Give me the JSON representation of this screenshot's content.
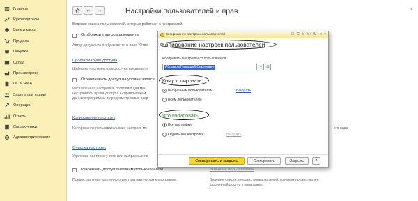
{
  "sidebar": {
    "items": [
      {
        "label": "Главное",
        "icon": "menu-icon"
      },
      {
        "label": "Руководителю",
        "icon": "chart-line-icon"
      },
      {
        "label": "Банк и касса",
        "icon": "coin-icon"
      },
      {
        "label": "Продажи",
        "icon": "cart-icon"
      },
      {
        "label": "Покупки",
        "icon": "basket-icon"
      },
      {
        "label": "Склад",
        "icon": "warehouse-icon"
      },
      {
        "label": "Производство",
        "icon": "factory-icon"
      },
      {
        "label": "ОС и НМА",
        "icon": "building-icon"
      },
      {
        "label": "Зарплата и кадры",
        "icon": "people-icon"
      },
      {
        "label": "Операции",
        "icon": "operations-icon"
      },
      {
        "label": "Отчеты",
        "icon": "report-icon"
      },
      {
        "label": "Справочники",
        "icon": "book-icon"
      },
      {
        "label": "Администрирование",
        "icon": "gear-icon"
      }
    ]
  },
  "header": {
    "title": "Настройки пользователей и прав",
    "back": "←",
    "forward": "→",
    "close": "×"
  },
  "background": {
    "intro": "Ведение списка пользователей, которые работают с программой.",
    "show_author": "Отображать автора документа",
    "show_author_desc": "Автор документа отображается в поле \"Отве",
    "groups_link": "Профили групп доступа",
    "groups_desc": "Шаблоны настроек прав доступа пользовате",
    "restrict": "Ограничивать доступ на уровне записе",
    "restrict_desc1": "Расширенная настройка, позволяющая мен",
    "restrict_desc2": "настраивать права доступа к справочникам,",
    "restrict_desc3": "данным программы в предусмотренных разр",
    "copy_link": "Копирование настроек",
    "copy_desc": "Копирование пользовательских настроек ме",
    "view_suffix": "ого вида",
    "clear_link": "Очистка настроек",
    "clear_desc": "Удаление настроек у всех или выбранных по",
    "external": "Разрешить доступ внешним пользователям",
    "external_link": "Внешние пользователи",
    "external_desc": "Предоставление удаленного доступа партнерам к программе.",
    "external_link_desc1": "Ведение списка внешних пользователей, которым предоставлен",
    "external_link_desc2": "удаленный доступ к программе."
  },
  "modal": {
    "window_title": "Копирование настроек пользователей",
    "controls": [
      "☐",
      "☰",
      "M",
      "M+",
      "M-",
      "□",
      "×"
    ],
    "heading": "Копирование настроек пользователей",
    "from_label": "Копировать настройки от пользователя:",
    "from_value": "Абрамов Геннадий Сергеевич",
    "from_dropdown": "▾",
    "from_open": "⊡",
    "to_title": "Кому копировать",
    "to_options": [
      "Выбранным пользователям",
      "Всем пользователям"
    ],
    "to_select_link": "Выбрать",
    "what_title": "Что копировать",
    "what_options": [
      "Все настройки",
      "Отдельные настройки:"
    ],
    "what_select_link": "Выбрать",
    "btn_copy_close": "Скопировать и закрыть",
    "btn_copy": "Скопировать",
    "btn_close": "Закрыть",
    "btn_help": "?"
  }
}
